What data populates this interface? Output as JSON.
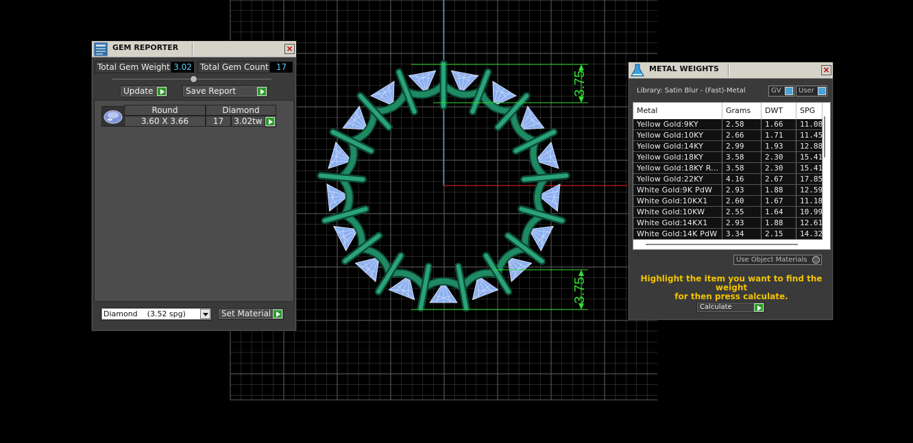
{
  "gem_reporter": {
    "title": "GEM REPORTER",
    "close": "×",
    "total_gem_weight_label": "Total Gem Weight",
    "total_gem_weight_value": "3.02",
    "total_gem_count_label": "Total Gem Count",
    "total_gem_count_value": "17",
    "update_label": "Update",
    "save_report_label": "Save Report",
    "gem_row": {
      "shape": "Round",
      "material": "Diamond",
      "size": "3.60 X 3.66",
      "count": "17",
      "weight": "3.02tw"
    },
    "material_select": "Diamond    (3.52 spg)",
    "set_material_label": "Set Material"
  },
  "metal_weights": {
    "title": "METAL WEIGHTS",
    "close": "×",
    "library_label": "Library: Satin Blur - (Fast)-Metal",
    "gv_label": "GV",
    "user_label": "User",
    "columns": [
      "Metal",
      "Grams",
      "DWT",
      "SPG"
    ],
    "rows": [
      [
        "Yellow Gold:9KY",
        "2.58",
        "1.66",
        "11.08"
      ],
      [
        "Yellow Gold:10KY",
        "2.66",
        "1.71",
        "11.45"
      ],
      [
        "Yellow Gold:14KY",
        "2.99",
        "1.93",
        "12.88"
      ],
      [
        "Yellow Gold:18KY",
        "3.58",
        "2.30",
        "15.41"
      ],
      [
        "Yellow Gold:18KY R...",
        "3.58",
        "2.30",
        "15.41"
      ],
      [
        "Yellow Gold:22KY",
        "4.16",
        "2.67",
        "17.85"
      ],
      [
        "White Gold:9K PdW",
        "2.93",
        "1.88",
        "12.59"
      ],
      [
        "White Gold:10KX1",
        "2.60",
        "1.67",
        "11.18"
      ],
      [
        "White Gold:10KW",
        "2.55",
        "1.64",
        "10.99"
      ],
      [
        "White Gold:14KX1",
        "2.93",
        "1.88",
        "12.61"
      ],
      [
        "White Gold:14K PdW",
        "3.34",
        "2.15",
        "14.32"
      ]
    ],
    "use_object_materials_label": "Use Object Materials",
    "hint_line1": "Highlight the item you want to find the weight",
    "hint_line2": "for then press calculate.",
    "calculate_label": "Calculate"
  },
  "viewport": {
    "dimension_top": "3.75",
    "dimension_bottom": "3.75",
    "gem_count": 17,
    "colors": {
      "metal": "#1f8a63",
      "gem": "#8db0f0",
      "dimension": "#2fe02f",
      "axis_x": "#c81e1e",
      "axis_y": "#2aa6c8",
      "grid": "#6e6e6e"
    }
  }
}
